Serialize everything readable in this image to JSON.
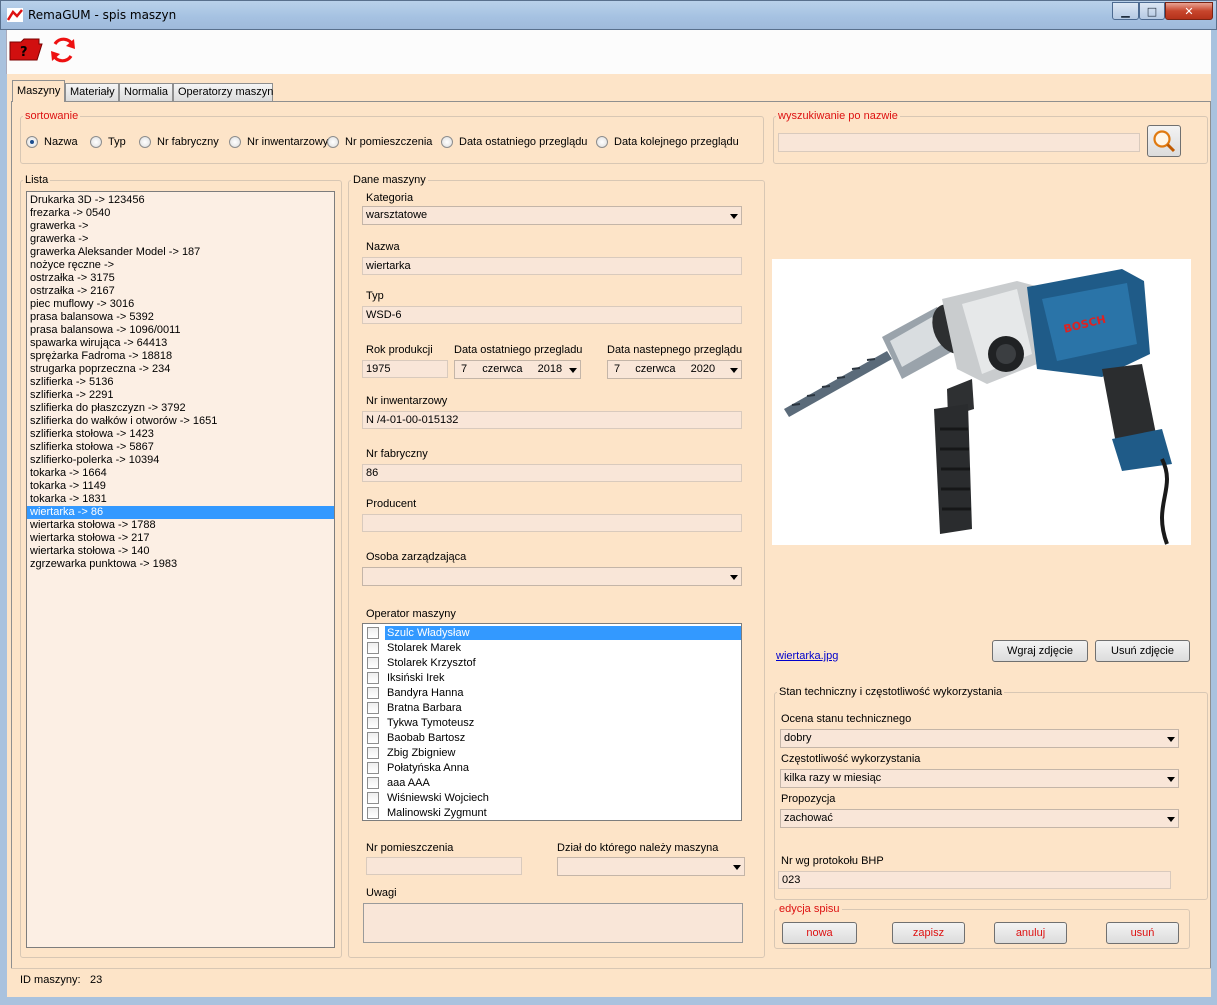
{
  "window": {
    "title": "RemaGUM - spis maszyn",
    "min": "▁",
    "max": "□",
    "close": "✕"
  },
  "tabs": [
    "Maszyny",
    "Materiały",
    "Normalia",
    "Operatorzy maszyn"
  ],
  "sort": {
    "legend": "sortowanie",
    "options": [
      "Nazwa",
      "Typ",
      "Nr fabryczny",
      "Nr inwentarzowy",
      "Nr pomieszczenia",
      "Data ostatniego przeglądu",
      "Data kolejnego przeglądu"
    ],
    "selected": "Nazwa"
  },
  "search": {
    "legend": "wyszukiwanie po nazwie",
    "value": ""
  },
  "list": {
    "legend": "Lista",
    "items": [
      "Drukarka 3D -> 123456",
      "frezarka -> 0540",
      "grawerka ->",
      "grawerka ->",
      "grawerka Aleksander Model -> 187",
      "nożyce ręczne ->",
      "ostrzałka -> 3175",
      "ostrzałka -> 2167",
      "piec muflowy -> 3016",
      "prasa balansowa -> 5392",
      "prasa balansowa -> 1096/0011",
      "spawarka wirująca -> 64413",
      "sprężarka Fadroma -> 18818",
      "strugarka poprzeczna -> 234",
      "szlifierka -> 5136",
      "szlifierka -> 2291",
      "szlifierka do płaszczyzn -> 3792",
      "szlifierka do wałków i otworów -> 1651",
      "szlifierka stołowa -> 1423",
      "szlifierka stołowa -> 5867",
      "szlifierko-polerka -> 10394",
      "tokarka -> 1664",
      "tokarka -> 1149",
      "tokarka -> 1831",
      "wiertarka -> 86",
      "wiertarka stołowa -> 1788",
      "wiertarka stołowa -> 217",
      "wiertarka stołowa -> 140",
      "zgrzewarka punktowa -> 1983"
    ],
    "selected_index": 24
  },
  "details": {
    "legend": "Dane maszyny",
    "kategoria_label": "Kategoria",
    "kategoria": "warsztatowe",
    "nazwa_label": "Nazwa",
    "nazwa": "wiertarka",
    "typ_label": "Typ",
    "typ": "WSD-6",
    "rok_label": "Rok produkcji",
    "rok": "1975",
    "data_ost_label": "Data ostatniego przegladu",
    "data_ost": {
      "day": "7",
      "month": "czerwca",
      "year": "2018"
    },
    "data_nast_label": "Data nastepnego przeglądu",
    "data_nast": {
      "day": "7",
      "month": "czerwca",
      "year": "2020"
    },
    "nr_inw_label": "Nr inwentarzowy",
    "nr_inw": "N /4-01-00-015132",
    "nr_fab_label": "Nr fabryczny",
    "nr_fab": "86",
    "producent_label": "Producent",
    "producent": "",
    "osoba_label": "Osoba zarządzająca",
    "osoba": "",
    "operator_label": "Operator maszyny",
    "operators": [
      "Szulc Władysław",
      "Stolarek Marek",
      "Stolarek Krzysztof",
      "Iksiński Irek",
      "Bandyra Hanna",
      "Bratna Barbara",
      "Tykwa Tymoteusz",
      "Baobab Bartosz",
      "Zbig Zbigniew",
      "Połatyńska Anna",
      "aaa AAA",
      "Wiśniewski Wojciech",
      "Malinowski Zygmunt"
    ],
    "operator_selected_index": 0,
    "nr_pom_label": "Nr pomieszczenia",
    "nr_pom": "",
    "dzial_label": "Dział do którego należy maszyna",
    "dzial": "",
    "uwagi_label": "Uwagi",
    "uwagi": ""
  },
  "photo": {
    "filename": "wiertarka.jpg",
    "load_button": "Wgraj zdjęcie",
    "remove_button": "Usuń zdjęcie"
  },
  "stan": {
    "legend": "Stan techniczny i częstotliwość wykorzystania",
    "ocena_label": "Ocena stanu technicznego",
    "ocena": "dobry",
    "czest_label": "Częstotliwość wykorzystania",
    "czest": "kilka razy w miesiąc",
    "prop_label": "Propozycja",
    "prop": "zachować",
    "bhp_label": "Nr wg protokołu BHP",
    "bhp": "023"
  },
  "edycja": {
    "legend": "edycja spisu",
    "buttons": [
      "nowa",
      "zapisz",
      "anuluj",
      "usuń"
    ]
  },
  "status": {
    "label": "ID maszyny:",
    "value": "23"
  },
  "colors": {
    "background": "#fde4c8",
    "selection": "#3399ff",
    "accent_red": "#dd1111"
  }
}
